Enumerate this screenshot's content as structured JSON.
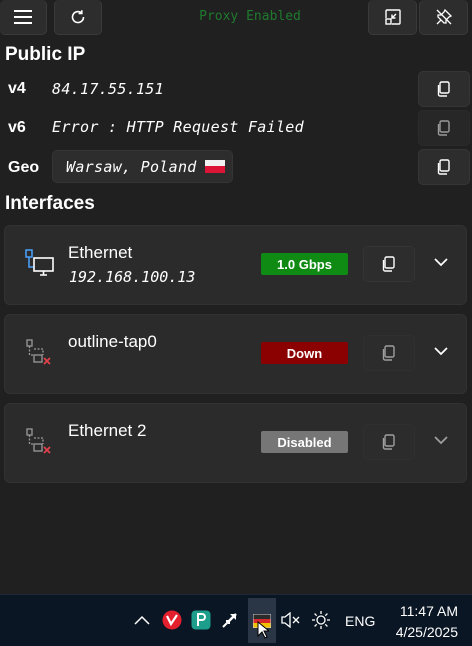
{
  "toolbar": {
    "status_text": "Proxy Enabled",
    "buttons": [
      "menu-icon",
      "refresh-icon",
      "collapse-icon",
      "unpin-icon"
    ]
  },
  "public_ip": {
    "title": "Public IP",
    "v4": {
      "label": "v4",
      "value": "84.17.55.151"
    },
    "v6": {
      "label": "v6",
      "value": "Error : HTTP Request Failed"
    },
    "geo": {
      "label": "Geo",
      "value": "Warsaw, Poland",
      "flag": "poland-flag-icon"
    }
  },
  "interfaces": {
    "title": "Interfaces",
    "items": [
      {
        "name": "Ethernet",
        "ip": "192.168.100.13",
        "status": "1.0 Gbps",
        "status_color": "#0f8a12",
        "connected": true
      },
      {
        "name": "outline-tap0",
        "ip": "",
        "status": "Down",
        "status_color": "#8b0000",
        "connected": false
      },
      {
        "name": "Ethernet 2",
        "ip": "",
        "status": "Disabled",
        "status_color": "#767676",
        "connected": false
      }
    ]
  },
  "taskbar": {
    "language": "ENG",
    "time": "11:47 AM",
    "date": "4/25/2025",
    "icons": [
      "chevron-up-icon",
      "vivaldi-icon",
      "app-p-icon",
      "arrow-app-icon",
      "flag-app-icon",
      "speaker-muted-icon",
      "brightness-icon"
    ]
  },
  "colors": {
    "background": "#202020",
    "ok": "#0f8a12",
    "down": "#8b0000",
    "disabled": "#767676",
    "status_text": "#1f7a2e"
  }
}
